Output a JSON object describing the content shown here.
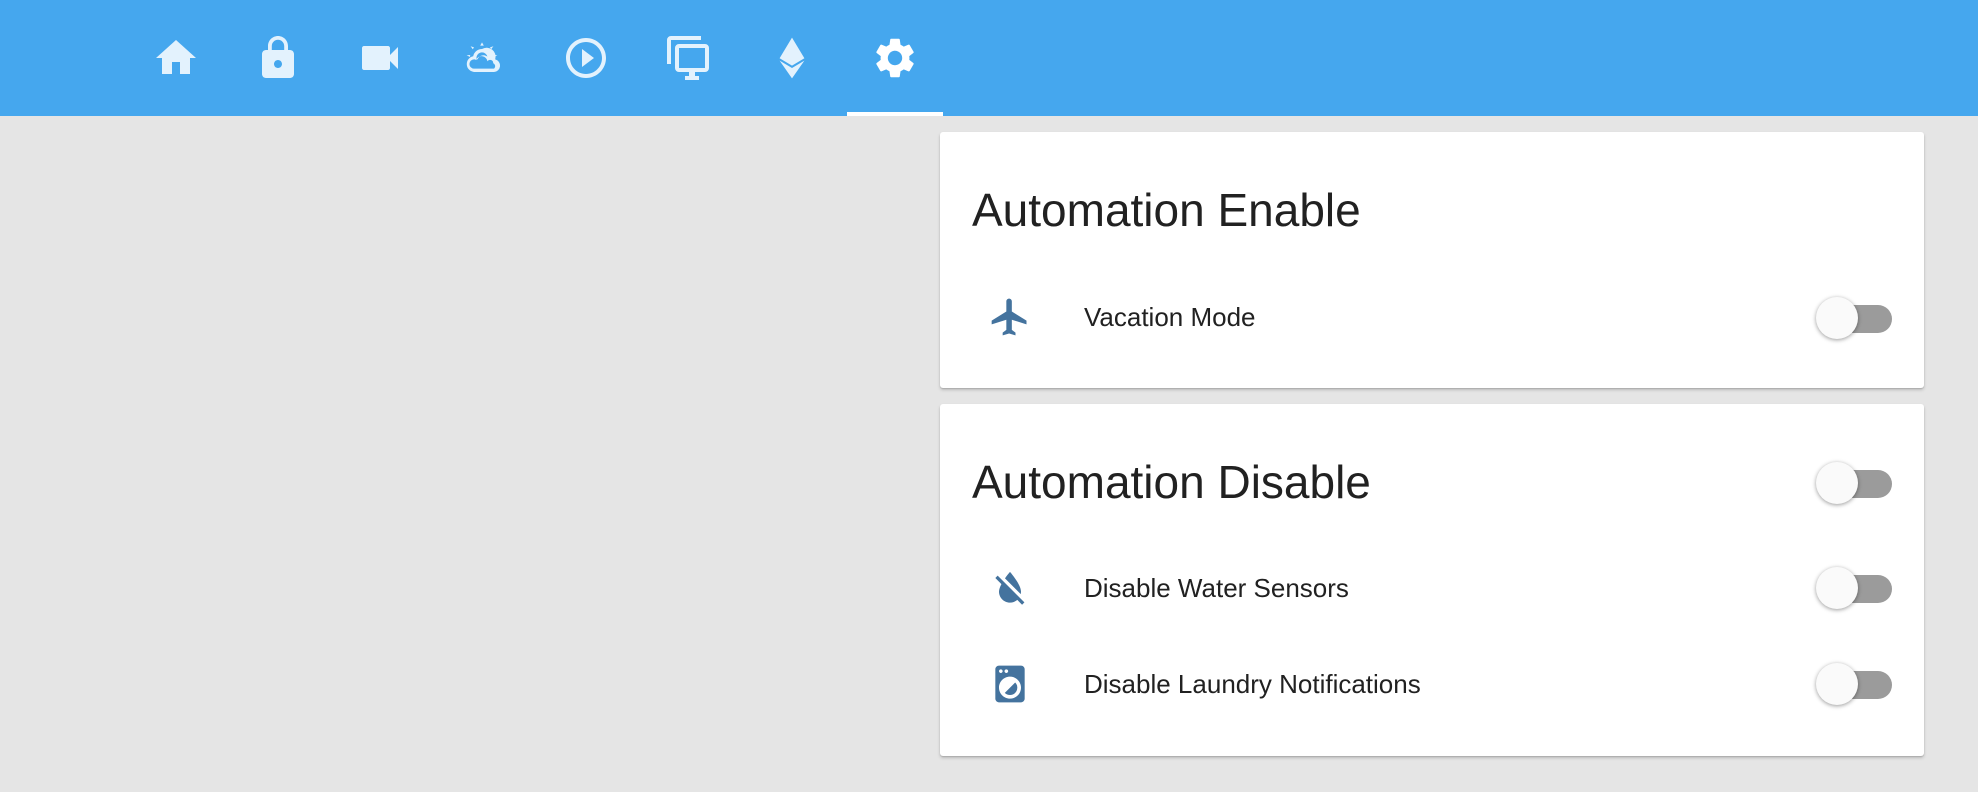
{
  "header": {
    "tabs": [
      {
        "icon": "home-icon"
      },
      {
        "icon": "lock-icon"
      },
      {
        "icon": "video-camera-icon"
      },
      {
        "icon": "weather-sunset-icon"
      },
      {
        "icon": "play-circle-icon"
      },
      {
        "icon": "monitor-multiple-icon"
      },
      {
        "icon": "ethereum-icon"
      },
      {
        "icon": "settings-icon",
        "active": true
      }
    ],
    "colors": {
      "bar": "#45a7ee",
      "icon": "#e3f2fd",
      "active_indicator": "#ffffff"
    }
  },
  "cards": [
    {
      "title": "Automation Enable",
      "rows": [
        {
          "icon": "airplane-icon",
          "label": "Vacation Mode",
          "state": "off"
        }
      ]
    },
    {
      "title": "Automation Disable",
      "title_toggle_state": "off",
      "rows": [
        {
          "icon": "water-off-icon",
          "label": "Disable Water Sensors",
          "state": "off"
        },
        {
          "icon": "washing-machine-icon",
          "label": "Disable Laundry Notifications",
          "state": "off"
        }
      ]
    }
  ],
  "colors": {
    "row_icon": "#44739e",
    "toggle_off_track": "#9b9b9b",
    "background": "#e5e5e5"
  }
}
